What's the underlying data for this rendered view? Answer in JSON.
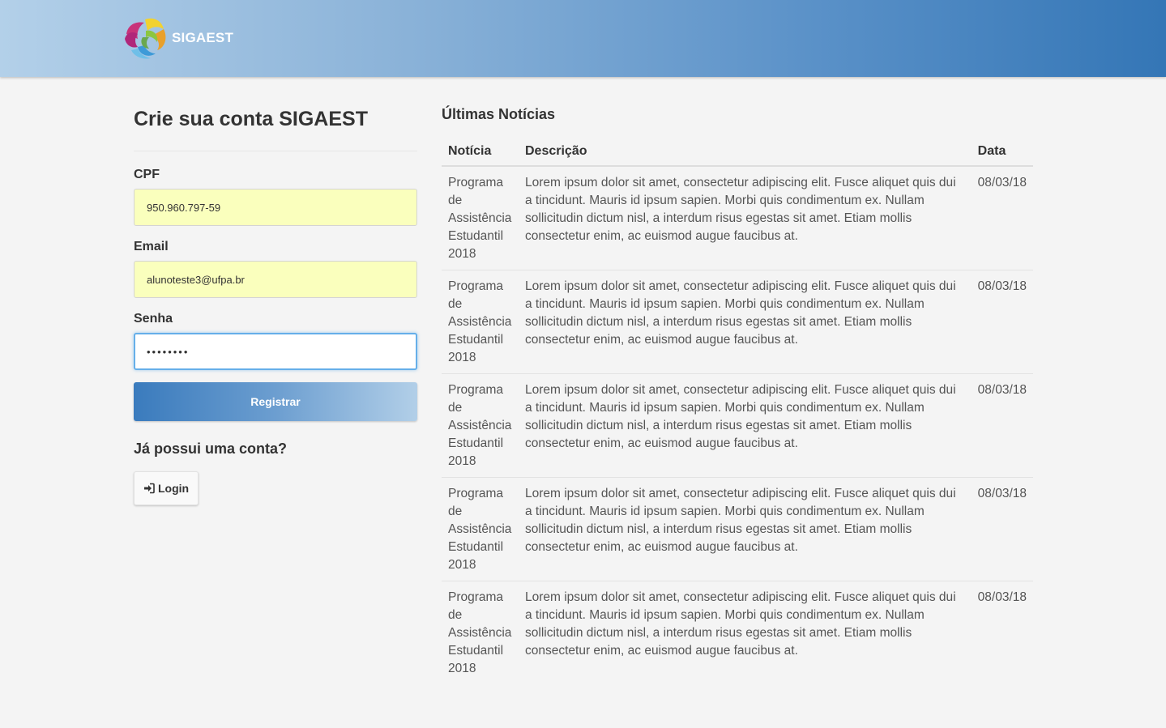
{
  "header": {
    "brand_name": "SIGAEST"
  },
  "form": {
    "title": "Crie sua conta SIGAEST",
    "cpf_label": "CPF",
    "cpf_value": "950.960.797-59",
    "email_label": "Email",
    "email_value": "alunoteste3@ufpa.br",
    "senha_label": "Senha",
    "senha_value": "••••••••",
    "register_button": "Registrar",
    "have_account_text": "Já possui uma conta?",
    "login_button": "Login"
  },
  "news": {
    "title": "Últimas Notícias",
    "columns": [
      "Notícia",
      "Descrição",
      "Data"
    ],
    "rows": [
      {
        "noticia": "Programa de Assistência Estudantil 2018",
        "descricao": "Lorem ipsum dolor sit amet, consectetur adipiscing elit. Fusce aliquet quis dui a tincidunt. Mauris id ipsum sapien. Morbi quis condimentum ex. Nullam sollicitudin dictum nisl, a interdum risus egestas sit amet. Etiam mollis consectetur enim, ac euismod augue faucibus at.",
        "data": "08/03/18"
      },
      {
        "noticia": "Programa de Assistência Estudantil 2018",
        "descricao": "Lorem ipsum dolor sit amet, consectetur adipiscing elit. Fusce aliquet quis dui a tincidunt. Mauris id ipsum sapien. Morbi quis condimentum ex. Nullam sollicitudin dictum nisl, a interdum risus egestas sit amet. Etiam mollis consectetur enim, ac euismod augue faucibus at.",
        "data": "08/03/18"
      },
      {
        "noticia": "Programa de Assistência Estudantil 2018",
        "descricao": "Lorem ipsum dolor sit amet, consectetur adipiscing elit. Fusce aliquet quis dui a tincidunt. Mauris id ipsum sapien. Morbi quis condimentum ex. Nullam sollicitudin dictum nisl, a interdum risus egestas sit amet. Etiam mollis consectetur enim, ac euismod augue faucibus at.",
        "data": "08/03/18"
      },
      {
        "noticia": "Programa de Assistência Estudantil 2018",
        "descricao": "Lorem ipsum dolor sit amet, consectetur adipiscing elit. Fusce aliquet quis dui a tincidunt. Mauris id ipsum sapien. Morbi quis condimentum ex. Nullam sollicitudin dictum nisl, a interdum risus egestas sit amet. Etiam mollis consectetur enim, ac euismod augue faucibus at.",
        "data": "08/03/18"
      },
      {
        "noticia": "Programa de Assistência Estudantil 2018",
        "descricao": "Lorem ipsum dolor sit amet, consectetur adipiscing elit. Fusce aliquet quis dui a tincidunt. Mauris id ipsum sapien. Morbi quis condimentum ex. Nullam sollicitudin dictum nisl, a interdum risus egestas sit amet. Etiam mollis consectetur enim, ac euismod augue faucibus at.",
        "data": "08/03/18"
      }
    ]
  }
}
